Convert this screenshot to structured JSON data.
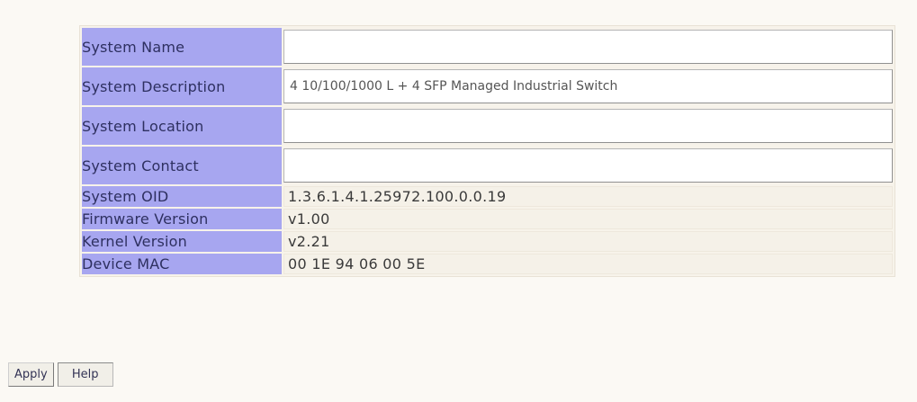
{
  "form": {
    "system_name": {
      "label": "System Name",
      "value": ""
    },
    "system_description": {
      "label": "System Description",
      "value": "4 10/100/1000 L + 4 SFP Managed Industrial Switch"
    },
    "system_location": {
      "label": "System Location",
      "value": ""
    },
    "system_contact": {
      "label": "System Contact",
      "value": ""
    }
  },
  "info": {
    "system_oid": {
      "label": "System OID",
      "value": "1.3.6.1.4.1.25972.100.0.0.19"
    },
    "firmware_version": {
      "label": "Firmware Version",
      "value": "v1.00"
    },
    "kernel_version": {
      "label": "Kernel Version",
      "value": "v2.21"
    },
    "device_mac": {
      "label": "Device MAC",
      "value": "00 1E 94 06 00 5E"
    }
  },
  "buttons": {
    "apply": "Apply",
    "help": "Help"
  }
}
